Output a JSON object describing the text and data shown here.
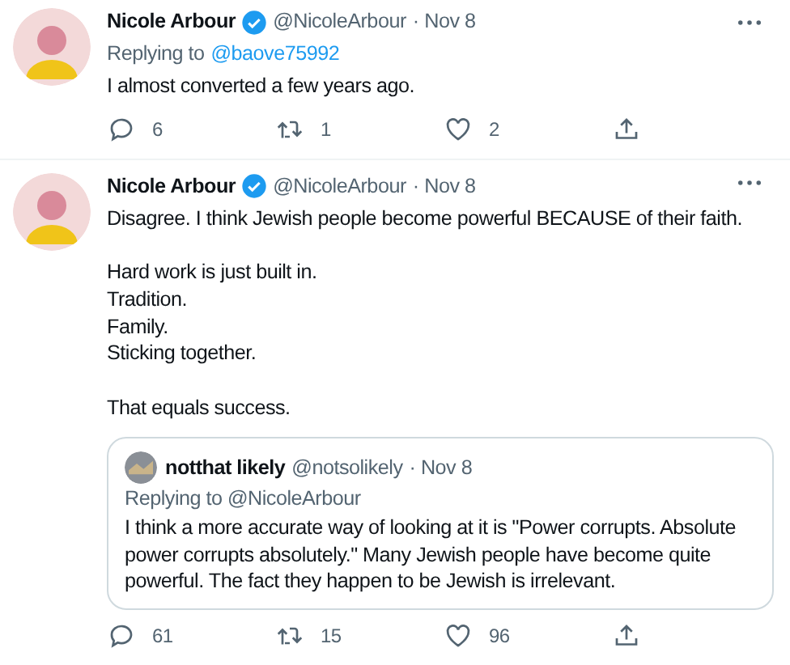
{
  "tweets": [
    {
      "name": "Nicole Arbour",
      "verified": true,
      "handle": "@NicoleArbour",
      "date": "· Nov 8",
      "replying_label": "Replying to",
      "replying_to": "@baove75992",
      "text": "I almost converted a few years ago.",
      "actions": [
        {
          "kind": "reply",
          "count": "6"
        },
        {
          "kind": "retweet",
          "count": "1"
        },
        {
          "kind": "like",
          "count": "2"
        },
        {
          "kind": "share"
        }
      ]
    },
    {
      "name": "Nicole Arbour",
      "verified": true,
      "handle": "@NicoleArbour",
      "date": "· Nov 8",
      "text": "Disagree. I think Jewish people become powerful BECAUSE of their faith.\n\nHard work is just built in.\nTradition.\nFamily.\nSticking together.\n\nThat equals success.",
      "quote": {
        "name": "notthat likely",
        "handle": "@notsolikely",
        "date": "· Nov 8",
        "replying": "Replying to @NicoleArbour",
        "text": "I think a more accurate way of looking at it is \"Power corrupts. Absolute power corrupts absolutely.\" Many Jewish people have become quite powerful. The fact they happen to be Jewish is irrelevant."
      },
      "actions": [
        {
          "kind": "reply",
          "count": "61"
        },
        {
          "kind": "retweet",
          "count": "15"
        },
        {
          "kind": "like",
          "count": "96"
        },
        {
          "kind": "share"
        }
      ]
    }
  ]
}
